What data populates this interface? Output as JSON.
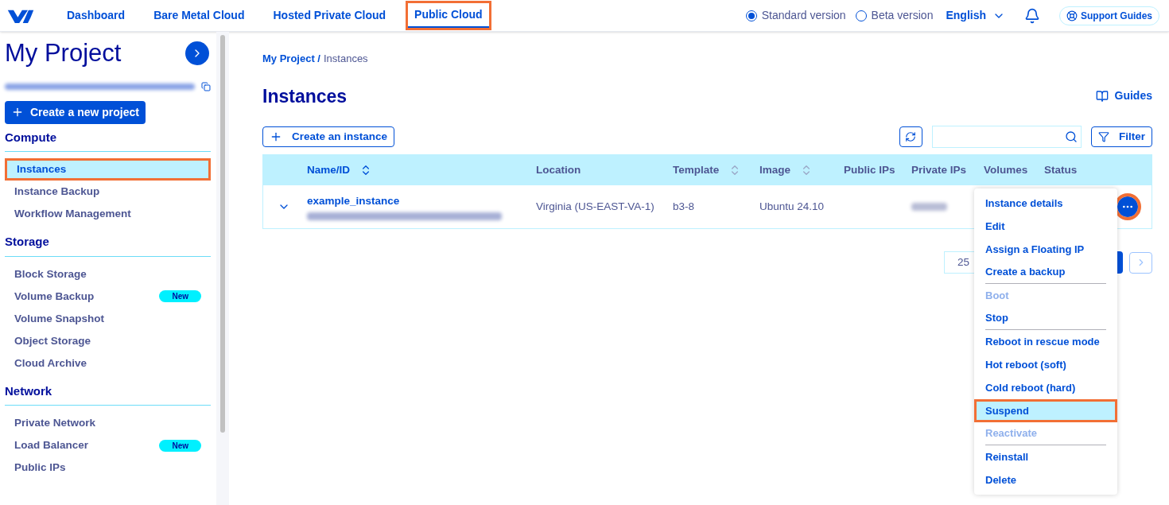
{
  "top_nav": {
    "links": [
      {
        "label": "Dashboard",
        "selected": false,
        "highlighted": false
      },
      {
        "label": "Bare Metal Cloud",
        "selected": false,
        "highlighted": false
      },
      {
        "label": "Hosted Private Cloud",
        "selected": false,
        "highlighted": false
      },
      {
        "label": "Public Cloud",
        "selected": true,
        "highlighted": true
      }
    ],
    "versions": [
      {
        "label": "Standard version",
        "selected": true
      },
      {
        "label": "Beta version",
        "selected": false
      }
    ],
    "language": "English",
    "support": "Support Guides"
  },
  "sidebar": {
    "title": "My Project",
    "create_button": "Create a new project",
    "sections": [
      {
        "title": "Compute",
        "items": [
          {
            "label": "Instances",
            "selected": true,
            "highlighted": true
          },
          {
            "label": "Instance Backup",
            "selected": false,
            "highlighted": false
          },
          {
            "label": "Workflow Management",
            "selected": false,
            "highlighted": false
          }
        ]
      },
      {
        "title": "Storage",
        "items": [
          {
            "label": "Block Storage",
            "selected": false,
            "highlighted": false
          },
          {
            "label": "Volume Backup",
            "selected": false,
            "highlighted": false,
            "badge": "New"
          },
          {
            "label": "Volume Snapshot",
            "selected": false,
            "highlighted": false
          },
          {
            "label": "Object Storage",
            "selected": false,
            "highlighted": false
          },
          {
            "label": "Cloud Archive",
            "selected": false,
            "highlighted": false
          }
        ]
      },
      {
        "title": "Network",
        "items": [
          {
            "label": "Private Network",
            "selected": false,
            "highlighted": false
          },
          {
            "label": "Load Balancer",
            "selected": false,
            "highlighted": false,
            "badge": "New"
          },
          {
            "label": "Public IPs",
            "selected": false,
            "highlighted": false
          }
        ]
      }
    ]
  },
  "breadcrumb": [
    {
      "label": "My Project",
      "kind": "link",
      "separator": "/"
    },
    {
      "label": "Instances",
      "kind": "current"
    }
  ],
  "page_title": "Instances",
  "guides": "Guides",
  "create_instance": "Create an instance",
  "filter": "Filter",
  "table": {
    "columns": [
      {
        "label": "Name/ID",
        "sortable": true,
        "sort_active": true
      },
      {
        "label": "Location",
        "sortable": false,
        "sort_active": false
      },
      {
        "label": "Template",
        "sortable": true,
        "sort_active": false
      },
      {
        "label": "Image",
        "sortable": true,
        "sort_active": false
      },
      {
        "label": "Public IPs",
        "sortable": false,
        "sort_active": false
      },
      {
        "label": "Private IPs",
        "sortable": false,
        "sort_active": false
      },
      {
        "label": "Volumes",
        "sortable": false,
        "sort_active": false
      },
      {
        "label": "Status",
        "sortable": false,
        "sort_active": false
      }
    ],
    "rows": [
      {
        "name": "example_instance",
        "location": "Virginia (US-EAST-VA-1)",
        "template": "b3-8",
        "image": "Ubuntu 24.10",
        "actions_highlighted": true
      }
    ]
  },
  "pagination": {
    "page_size": "25"
  },
  "action_menu": [
    {
      "label": "Instance details",
      "disabled": false,
      "highlighted": false,
      "divider_after": false
    },
    {
      "label": "Edit",
      "disabled": false,
      "highlighted": false,
      "divider_after": false
    },
    {
      "label": "Assign a Floating IP",
      "disabled": false,
      "highlighted": false,
      "divider_after": false
    },
    {
      "label": "Create a backup",
      "disabled": false,
      "highlighted": false,
      "divider_after": true
    },
    {
      "label": "Boot",
      "disabled": true,
      "highlighted": false,
      "divider_after": false
    },
    {
      "label": "Stop",
      "disabled": false,
      "highlighted": false,
      "divider_after": true
    },
    {
      "label": "Reboot in rescue mode",
      "disabled": false,
      "highlighted": false,
      "divider_after": false
    },
    {
      "label": "Hot reboot (soft)",
      "disabled": false,
      "highlighted": false,
      "divider_after": false
    },
    {
      "label": "Cold reboot (hard)",
      "disabled": false,
      "highlighted": false,
      "divider_after": false
    },
    {
      "label": "Suspend",
      "disabled": false,
      "highlighted": true,
      "divider_after": false
    },
    {
      "label": "Reactivate",
      "disabled": true,
      "highlighted": false,
      "divider_after": true
    },
    {
      "label": "Reinstall",
      "disabled": false,
      "highlighted": false,
      "divider_after": false
    },
    {
      "label": "Delete",
      "disabled": false,
      "highlighted": false,
      "divider_after": false
    }
  ]
}
